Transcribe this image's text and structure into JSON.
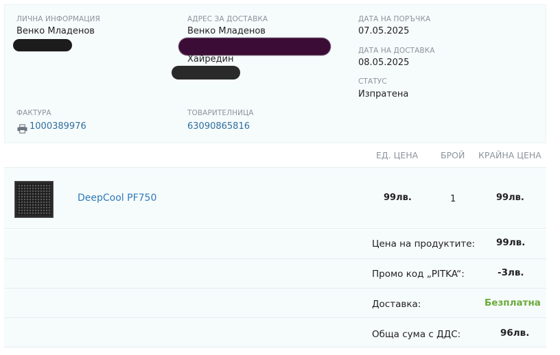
{
  "personal": {
    "label": "Лична информация",
    "name": "Венко Младенов"
  },
  "address": {
    "label": "Адрес за доставка",
    "name": "Венко Младенов",
    "city": "Хайредин"
  },
  "order_date": {
    "label": "Дата на поръчка",
    "value": "07.05.2025"
  },
  "delivery_date": {
    "label": "Дата на доставка",
    "value": "08.05.2025"
  },
  "status": {
    "label": "Статус",
    "value": "Изпратена"
  },
  "invoice": {
    "label": "Фактура",
    "number": "1000389976",
    "icon": "printer-icon"
  },
  "waybill": {
    "label": "Товарителница",
    "number": "63090865816"
  },
  "table": {
    "headers": [
      "Ед. цена",
      "Брой",
      "Крайна цена"
    ],
    "items": [
      {
        "name": "DeepCool PF750",
        "unit_price": "99лв.",
        "quantity": "1",
        "total": "99лв."
      }
    ]
  },
  "summary": [
    {
      "label": "Цена на продуктите:",
      "value": "99лв."
    },
    {
      "label": "Промо код „PITKA“:",
      "value": "-3лв."
    },
    {
      "label": "Доставка:",
      "value": "Безплатна"
    },
    {
      "label": "Обща сума с ДДС:",
      "value": "96лв."
    }
  ],
  "colors": {
    "panel_bg": "#f6fbfc",
    "link": "#2e6e9e",
    "product_link": "#2e7ab8",
    "free_shipping": "#6cab3a",
    "muted": "#8c949c"
  }
}
